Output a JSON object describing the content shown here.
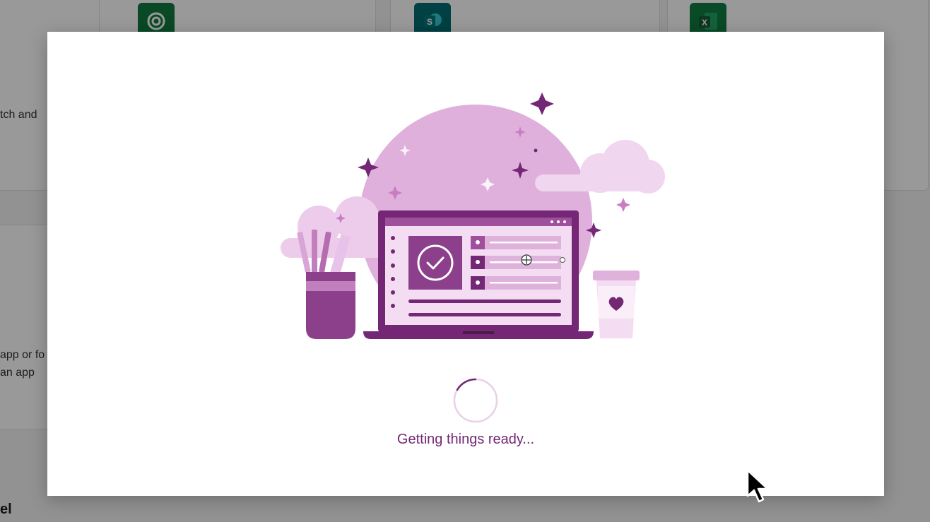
{
  "background": {
    "card_snippets": [
      "tch and",
      "app or fo",
      "an app"
    ],
    "section_heading": "el",
    "tiles": [
      {
        "icon": "dataverse-icon",
        "color": "#0f7a3e"
      },
      {
        "icon": "sharepoint-icon",
        "color": "#036c70",
        "letter": "S"
      },
      {
        "icon": "excel-icon",
        "color": "#107c41",
        "letter": "X"
      }
    ]
  },
  "dialog": {
    "status_text": "Getting things ready...",
    "illustration": "laptop-with-checklist-illustration",
    "spinner": "loading-spinner"
  },
  "colors": {
    "accent": "#742774",
    "light_purple": "#e8c2e8",
    "overlay": "rgba(0,0,0,0.4)"
  }
}
